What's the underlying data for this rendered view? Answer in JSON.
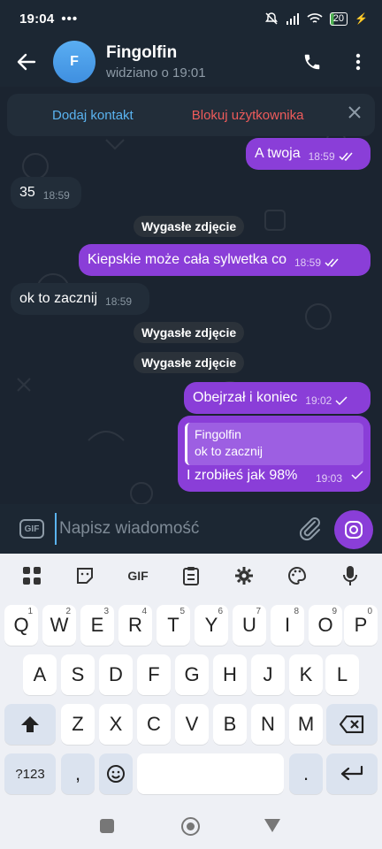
{
  "status": {
    "time": "19:04",
    "dots": "•••",
    "battery": "20"
  },
  "header": {
    "avatar_letter": "F",
    "name": "Fingolfin",
    "seen": "widziano o 19:01"
  },
  "banner": {
    "add": "Dodaj kontakt",
    "block": "Blokuj użytkownika"
  },
  "messages": {
    "m1": {
      "text": "A twoja",
      "time": "18:59"
    },
    "m2": {
      "text": "35",
      "time": "18:59"
    },
    "m3": {
      "text": "Wygasłe zdjęcie"
    },
    "m4": {
      "text": "Kiepskie może cała sylwetka co",
      "time": "18:59"
    },
    "m5": {
      "text": "ok to zacznij",
      "time": "18:59"
    },
    "m6": {
      "text": "Wygasłe zdjęcie"
    },
    "m7": {
      "text": "Wygasłe zdjęcie"
    },
    "m8": {
      "text": "Obejrzał i koniec",
      "time": "19:02"
    },
    "m9": {
      "reply_name": "Fingolfin",
      "reply_text": "ok to zacznij",
      "text": "I zrobiłeś jak 98%",
      "time": "19:03"
    }
  },
  "input": {
    "gif": "GIF",
    "placeholder": "Napisz wiadomość"
  },
  "keyboard": {
    "gif": "GIF",
    "row1": [
      [
        "Q",
        "1"
      ],
      [
        "W",
        "2"
      ],
      [
        "E",
        "3"
      ],
      [
        "R",
        "4"
      ],
      [
        "T",
        "5"
      ],
      [
        "Y",
        "6"
      ],
      [
        "U",
        "7"
      ],
      [
        "I",
        "8"
      ],
      [
        "O",
        "9"
      ],
      [
        "P",
        "0"
      ]
    ],
    "row2": [
      "A",
      "S",
      "D",
      "F",
      "G",
      "H",
      "J",
      "K",
      "L"
    ],
    "row3": [
      "Z",
      "X",
      "C",
      "V",
      "B",
      "N",
      "M"
    ],
    "sym": "?123",
    "comma": ",",
    "period": "."
  },
  "colors": {
    "outgoing": "#8a3ed8",
    "incoming": "#222d39",
    "accent": "#5ab3f0",
    "danger": "#ee5b5b"
  }
}
